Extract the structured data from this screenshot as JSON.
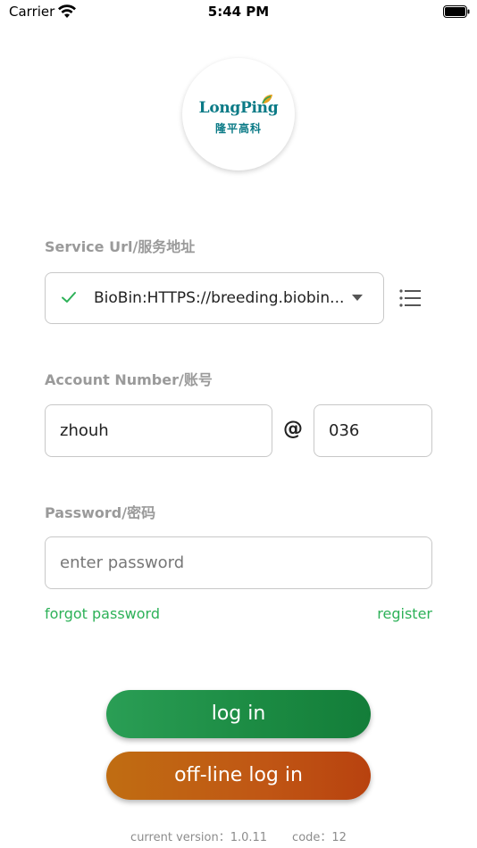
{
  "status_bar": {
    "carrier": "Carrier",
    "time": "5:44 PM"
  },
  "logo": {
    "name": "LongPing",
    "subtitle": "隆平高科"
  },
  "service": {
    "label": "Service Url/服务地址",
    "selected": "BioBin:HTTPS://breeding.biobin..."
  },
  "account": {
    "label": "Account Number/账号",
    "username": "zhouh",
    "at_symbol": "@",
    "domain": "036"
  },
  "password": {
    "label": "Password/密码",
    "placeholder": "enter password",
    "value": ""
  },
  "links": {
    "forgot": "forgot password",
    "register": "register"
  },
  "buttons": {
    "login": "log in",
    "offline_login": "off-line log in"
  },
  "footer": {
    "version": "current version：1.0.11",
    "code": "code：12"
  },
  "colors": {
    "accent_green": "#2db158",
    "logo_teal": "#0a7a86",
    "login_button": "#1b8a42",
    "offline_button": "#c05614"
  }
}
